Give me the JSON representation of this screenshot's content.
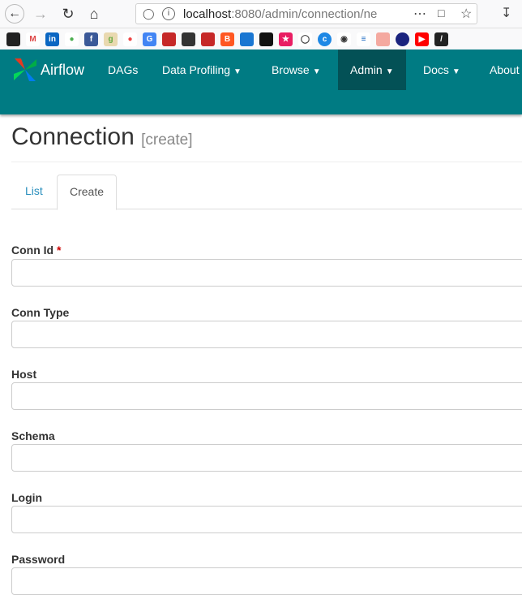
{
  "browser": {
    "url_host": "localhost",
    "url_rest": ":8080/admin/connection/ne",
    "icons": [
      "back-icon",
      "forward-icon",
      "reload-icon",
      "home-icon",
      "shield-icon",
      "info-icon",
      "more-dots-icon",
      "pocket-icon",
      "star-icon",
      "download-icon"
    ]
  },
  "navbar": {
    "brand": "Airflow",
    "items": [
      {
        "label": "DAGs"
      },
      {
        "label": "Data Profiling",
        "caret": "❯"
      },
      {
        "label": "Browse",
        "caret": "❯"
      },
      {
        "label": "Admin",
        "caret": "❯"
      },
      {
        "label": "Docs",
        "caret": "❯"
      },
      {
        "label": "About"
      }
    ]
  },
  "page": {
    "title": "Connection",
    "subtitle": "[create]",
    "tabs": {
      "list": "List",
      "create": "Create"
    }
  },
  "form": {
    "fields": [
      {
        "label": "Conn Id",
        "required": "*",
        "value": ""
      },
      {
        "label": "Conn Type",
        "value": ""
      },
      {
        "label": "Host",
        "value": ""
      },
      {
        "label": "Schema",
        "value": ""
      },
      {
        "label": "Login",
        "value": ""
      },
      {
        "label": "Password",
        "value": ""
      }
    ]
  },
  "colors": {
    "navbar": "#007b83",
    "active_nav": "#035156",
    "link": "#2a8fbd"
  }
}
